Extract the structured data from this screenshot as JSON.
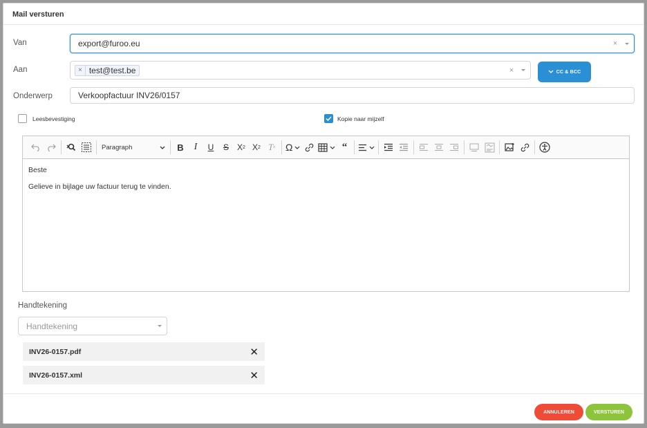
{
  "modal": {
    "title": "Mail versturen"
  },
  "from": {
    "label": "Van",
    "value": "export@furoo.eu",
    "clear": "×"
  },
  "to": {
    "label": "Aan",
    "tags": [
      "test@test.be"
    ],
    "tag_remove": "×",
    "clear": "×",
    "cc_label": "CC & BCC"
  },
  "subject": {
    "label": "Onderwerp",
    "value": "Verkoopfactuur INV26/0157"
  },
  "checkboxes": {
    "read_receipt": {
      "label": "Leesbevestiging",
      "checked": false
    },
    "copy_to_self": {
      "label": "Kopie naar mijzelf",
      "checked": true
    }
  },
  "editor": {
    "paragraph_select": "Paragraph",
    "body": [
      "Beste",
      "Gelieve in bijlage uw factuur terug te vinden."
    ],
    "toolbar_icons": [
      "undo-icon",
      "redo-icon",
      "find-replace-icon",
      "select-all-icon",
      "bold-icon",
      "italic-icon",
      "underline-icon",
      "strikethrough-icon",
      "subscript-icon",
      "superscript-icon",
      "remove-format-icon",
      "special-characters-icon",
      "link-icon",
      "table-icon",
      "blockquote-icon",
      "align-icon",
      "indent-icon",
      "outdent-icon",
      "image-left-icon",
      "image-center-icon",
      "image-right-icon",
      "image-caption-icon",
      "image-text-alt-icon",
      "insert-image-icon",
      "link-image-icon",
      "accessibility-icon"
    ]
  },
  "signature": {
    "label": "Handtekening",
    "placeholder": "Handtekening"
  },
  "attachments": [
    {
      "name": "INV26-0157.pdf",
      "remove": "✕"
    },
    {
      "name": "INV26-0157.xml",
      "remove": "✕"
    }
  ],
  "footer": {
    "cancel_label": "ANNULEREN",
    "send_label": "VERSTUREN"
  },
  "colors": {
    "primary": "#2b8fd6",
    "cancel": "#ee4c37",
    "send": "#8cc43c"
  }
}
